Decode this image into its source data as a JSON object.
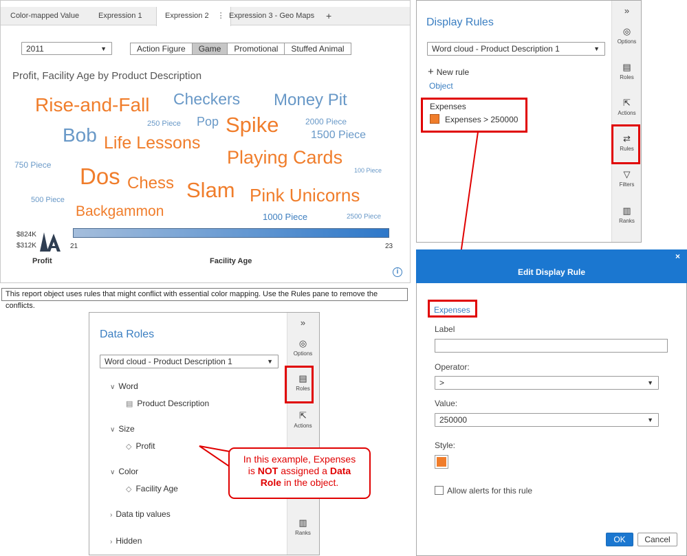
{
  "report": {
    "tabs": [
      "Color-mapped Value",
      "Expression 1",
      "Expression 2",
      "Expression 3 - Geo Maps"
    ],
    "active_tab": "Expression 2",
    "add_tab_label": "+",
    "year_select": "2011",
    "button_group": [
      "Action Figure",
      "Game",
      "Promotional",
      "Stuffed Animal"
    ],
    "selected_button": "Game",
    "title": "Profit, Facility Age by Product Description",
    "words": [
      {
        "text": "Rise-and-Fall",
        "color": "#f07d2b"
      },
      {
        "text": "Checkers",
        "color": "#6898c7"
      },
      {
        "text": "Money Pit",
        "color": "#6898c7"
      },
      {
        "text": "250 Piece",
        "color": "#6898c7"
      },
      {
        "text": "Pop",
        "color": "#6898c7"
      },
      {
        "text": "Spike",
        "color": "#f07d2b"
      },
      {
        "text": "2000 Piece",
        "color": "#6898c7"
      },
      {
        "text": "Bob",
        "color": "#6898c7"
      },
      {
        "text": "Life Lessons",
        "color": "#f07d2b"
      },
      {
        "text": "1500 Piece",
        "color": "#6898c7"
      },
      {
        "text": "750 Piece",
        "color": "#6898c7"
      },
      {
        "text": "Playing Cards",
        "color": "#f07d2b"
      },
      {
        "text": "100 Piece",
        "color": "#6898c7"
      },
      {
        "text": "Dos",
        "color": "#f07d2b"
      },
      {
        "text": "Chess",
        "color": "#f07d2b"
      },
      {
        "text": "Slam",
        "color": "#f07d2b"
      },
      {
        "text": "Pink Unicorns",
        "color": "#f07d2b"
      },
      {
        "text": "500 Piece",
        "color": "#6898c7"
      },
      {
        "text": "Backgammon",
        "color": "#f07d2b"
      },
      {
        "text": "1000 Piece",
        "color": "#3d7ebf"
      },
      {
        "text": "2500 Piece",
        "color": "#6898c7"
      }
    ],
    "legend": {
      "size_max": "$824K",
      "size_min": "$312K",
      "size_label": "Profit",
      "color_min": "21",
      "color_max": "23",
      "color_label": "Facility Age",
      "gradient_start": "#a5bedc",
      "gradient_end": "#2e78c9"
    },
    "info_icon": "info-icon"
  },
  "notice": "This report object uses rules that might conflict with essential color mapping. Use the Rules pane to remove the conflicts.",
  "data_roles": {
    "title": "Data Roles",
    "object_select": "Word cloud - Product Description 1",
    "sections": [
      {
        "label": "Word",
        "item": "Product Description"
      },
      {
        "label": "Size",
        "item": "Profit"
      },
      {
        "label": "Color",
        "item": "Facility Age"
      }
    ],
    "collapsed": [
      "Data tip values",
      "Hidden"
    ],
    "rail": {
      "collapse": "»",
      "options": "Options",
      "roles": "Roles",
      "actions": "Actions",
      "ranks": "Ranks"
    }
  },
  "callout": {
    "line1": "In this example, Expenses",
    "line2_pre": "is ",
    "line2_bold": "NOT",
    "line2_post": " assigned a ",
    "line2_bold2": "Data",
    "line3_bold": "Role",
    "line3_post": " in the object."
  },
  "display_rules": {
    "title": "Display Rules",
    "object_select": "Word cloud - Product Description 1",
    "new_rule": "New rule",
    "object_link": "Object",
    "rule_group": "Expenses",
    "rule": "Expenses > 250000",
    "rule_color": "#f07d2b",
    "rail": {
      "collapse": "»",
      "options": "Options",
      "roles": "Roles",
      "actions": "Actions",
      "rules": "Rules",
      "filters": "Filters",
      "ranks": "Ranks"
    }
  },
  "edit_dialog": {
    "title": "Edit Display Rule",
    "close": "×",
    "measure_link": "Expenses",
    "label_field_label": "Label",
    "label_value": "",
    "operator_label": "Operator:",
    "operator_value": ">",
    "value_label": "Value:",
    "value_value": "250000",
    "style_label": "Style:",
    "style_color": "#f07d2b",
    "alerts_label": "Allow alerts for this rule",
    "ok": "OK",
    "cancel": "Cancel"
  }
}
